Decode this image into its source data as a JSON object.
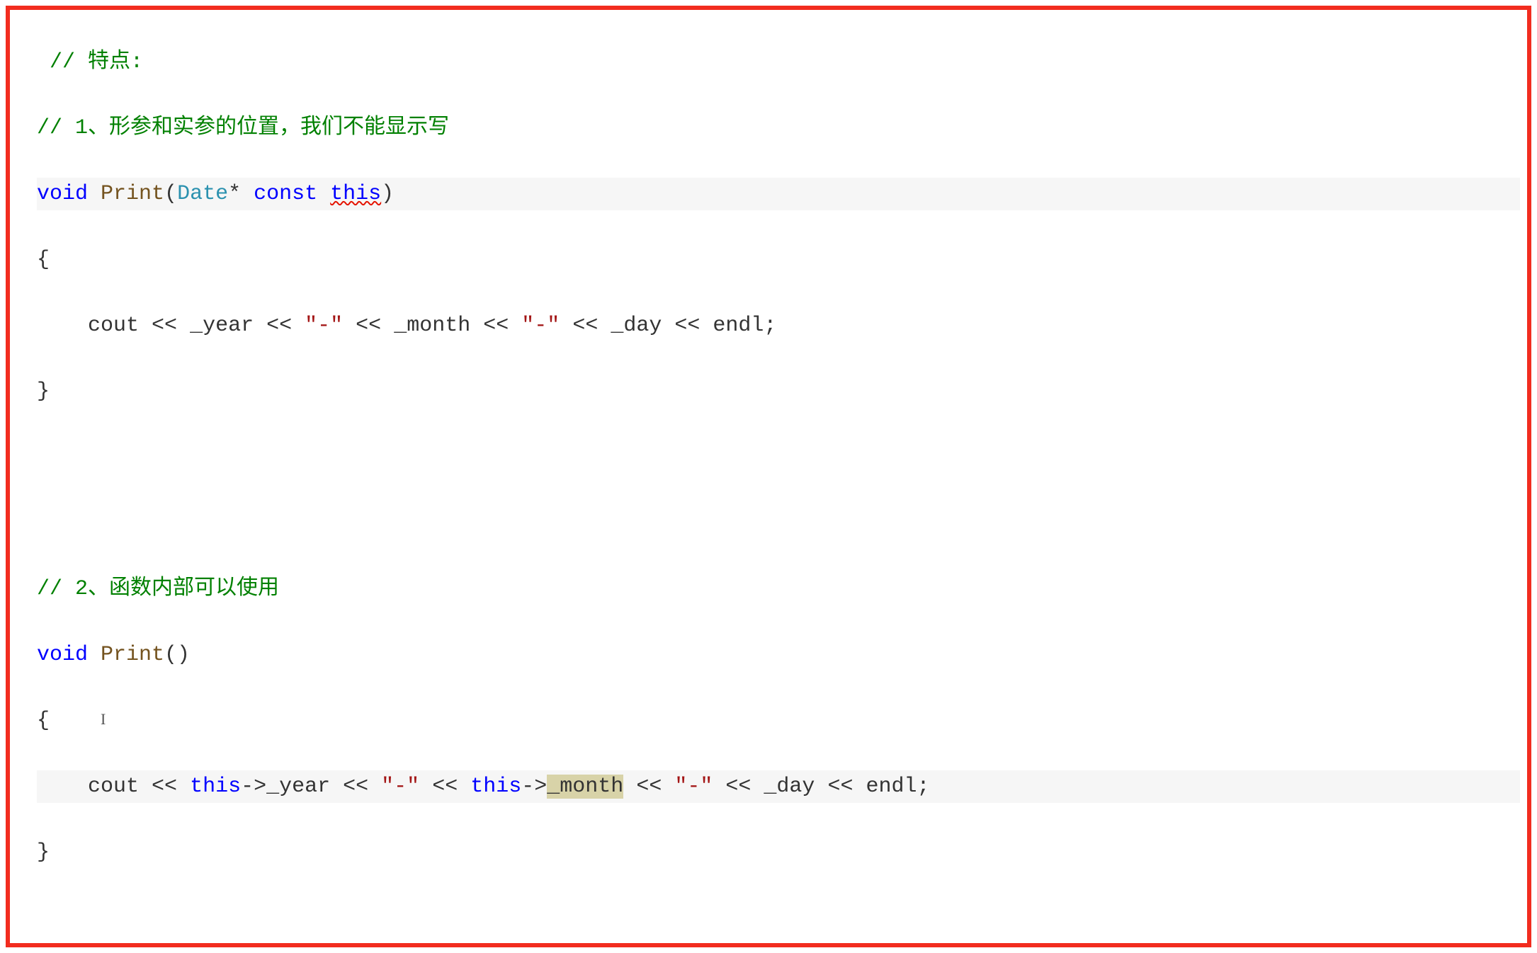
{
  "code": {
    "comment1a": " // 特点:",
    "comment1b": "// 1、形参和实参的位置，我们不能显示写",
    "fn1": {
      "kw_void": "void",
      "name": "Print",
      "lparen": "(",
      "param_type": "Date",
      "star": "*",
      "kw_const": "const",
      "param_name": "this",
      "rparen": ")",
      "open": "{",
      "body_cout": "cout",
      "body_op1": "<<",
      "body_year": "_year",
      "body_op2": "<<",
      "body_str1": "\"-\"",
      "body_op3": "<<",
      "body_month": "_month",
      "body_op4": "<<",
      "body_str2": "\"-\"",
      "body_op5": "<<",
      "body_day": "_day",
      "body_op6": "<<",
      "body_endl": "endl",
      "body_semi": ";",
      "close": "}"
    },
    "comment2": "// 2、函数内部可以使用",
    "fn2": {
      "kw_void": "void",
      "name": "Print",
      "parens": "()",
      "open": "{",
      "body_cout": "cout",
      "body_op1": "<<",
      "body_this1": "this",
      "body_arrow1": "->",
      "body_year": "_year",
      "body_op2": "<<",
      "body_str1": "\"-\"",
      "body_op3": "<<",
      "body_this2": "this",
      "body_arrow2": "->",
      "body_month": "_month",
      "body_op4": "<<",
      "body_str2": "\"-\"",
      "body_op5": "<<",
      "body_day": "_day",
      "body_op6": "<<",
      "body_endl": "endl",
      "body_semi": ";",
      "close": "}"
    },
    "ibeam": "I"
  }
}
